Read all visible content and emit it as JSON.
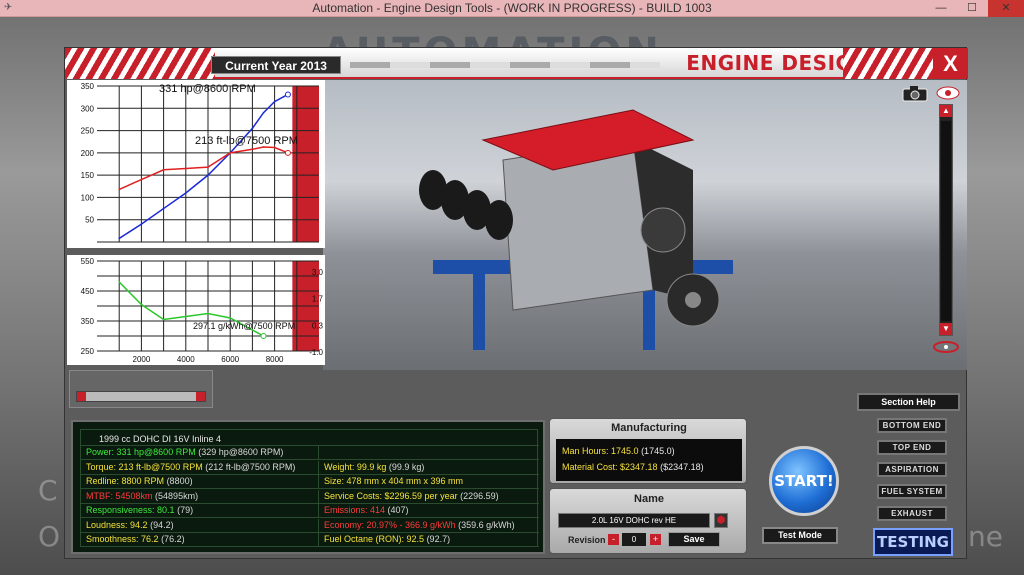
{
  "window": {
    "title": "Automation - Engine Design Tools - (WORK IN PROGRESS) - BUILD 1003",
    "minimize": "—",
    "maximize": "☐",
    "close": "✕"
  },
  "background": {
    "brand": "AUTOMATION",
    "ghost_left_1": "C",
    "ghost_left_2": "O",
    "ghost_right": "ne"
  },
  "header": {
    "current_year": "Current Year 2013",
    "title": "ENGINE DESIGN",
    "close_label": "X"
  },
  "section_help": "Section Help",
  "chart_data": [
    {
      "type": "line",
      "x": [
        1000,
        2000,
        3000,
        4000,
        5000,
        6000,
        7000,
        7500,
        8000,
        8600
      ],
      "xlim": [
        0,
        10000
      ],
      "ylim": [
        0,
        350
      ],
      "yticks": [
        50,
        100,
        150,
        200,
        250,
        300,
        350
      ],
      "annotations": [
        "331 hp@8600 RPM",
        "213 ft-lb@7500 RPM"
      ],
      "series": [
        {
          "values": [
            8,
            40,
            75,
            110,
            150,
            200,
            255,
            290,
            315,
            331
          ],
          "color": "#1a2ad6"
        },
        {
          "values": [
            118,
            140,
            162,
            165,
            168,
            200,
            208,
            213,
            212,
            200
          ],
          "color": "#e02020"
        }
      ],
      "redline_from": 8800
    },
    {
      "type": "line",
      "x": [
        1000,
        2000,
        3000,
        4000,
        5000,
        6000,
        7000,
        7500
      ],
      "xticks": [
        2000,
        4000,
        6000,
        8000
      ],
      "xlim": [
        0,
        10000
      ],
      "ylim": [
        250,
        550
      ],
      "yticks": [
        250,
        350,
        450,
        550
      ],
      "right_ticks": [
        "3.0",
        "1.7",
        "0.3",
        "-1.0"
      ],
      "annotations": [
        "297.1 g/kWh@7500 RPM"
      ],
      "series": [
        {
          "values": [
            480,
            405,
            355,
            365,
            375,
            360,
            320,
            300
          ],
          "color": "#2ac82a"
        }
      ]
    }
  ],
  "stats": {
    "engine_name": "1999 cc DOHC DI 16V Inline 4",
    "rows": [
      {
        "left_label": "Power: 331 hp@8600 RPM",
        "left_paren": "(329 hp@8600 RPM)",
        "left_color": "green",
        "right_label": "",
        "right_paren": "",
        "right_color": "yellow"
      },
      {
        "left_label": "Torque: 213 ft-lb@7500 RPM",
        "left_paren": "(212 ft-lb@7500 RPM)",
        "left_color": "yellow",
        "right_label": "Weight: 99.9 kg",
        "right_paren": "(99.9 kg)",
        "right_color": "yellow"
      },
      {
        "left_label": "Redline: 8800 RPM",
        "left_paren": "(8800)",
        "left_color": "yellow",
        "right_label": "Size: 478 mm x 404 mm x 396 mm",
        "right_paren": "",
        "right_color": "yellow"
      },
      {
        "left_label": "MTBF: 54508km",
        "left_paren": "(54895km)",
        "left_color": "red",
        "right_label": "Service Costs: $2296.59 per year",
        "right_paren": "(2296.59)",
        "right_color": "yellow"
      },
      {
        "left_label": "Responsiveness: 80.1",
        "left_paren": "(79)",
        "left_color": "green",
        "right_label": "Emissions: 414",
        "right_paren": "(407)",
        "right_color": "red"
      },
      {
        "left_label": "Loudness: 94.2",
        "left_paren": "(94.2)",
        "left_color": "yellow",
        "right_label": "Economy: 20.97% - 366.9 g/kWh",
        "right_paren": "(359.6 g/kWh)",
        "right_color": "red"
      },
      {
        "left_label": "Smoothness: 76.2",
        "left_paren": "(76.2)",
        "left_color": "yellow",
        "right_label": "Fuel Octane (RON): 92.5",
        "right_paren": "(92.7)",
        "right_color": "yellow"
      }
    ]
  },
  "manufacturing": {
    "title": "Manufacturing",
    "man_hours_label": "Man Hours: 1745.0",
    "man_hours_paren": "(1745.0)",
    "material_label": "Material Cost: $2347.18",
    "material_paren": "($2347.18)"
  },
  "name_panel": {
    "title": "Name",
    "name_value": "2.0L 16V DOHC rev HE",
    "revision_label": "Revision",
    "revision_value": "0",
    "minus": "-",
    "plus": "+",
    "save_label": "Save"
  },
  "start_label": "START!",
  "test_mode_label": "Test Mode",
  "sections": [
    "BOTTOM END",
    "TOP END",
    "ASPIRATION",
    "FUEL SYSTEM",
    "EXHAUST"
  ],
  "testing_label": "TESTING",
  "colors": {
    "accent_red": "#c8202a",
    "stat_green": "#3ee83e",
    "stat_yellow": "#f5e23a",
    "stat_red": "#ff3b3b",
    "start_blue": "#1f6fd6"
  }
}
